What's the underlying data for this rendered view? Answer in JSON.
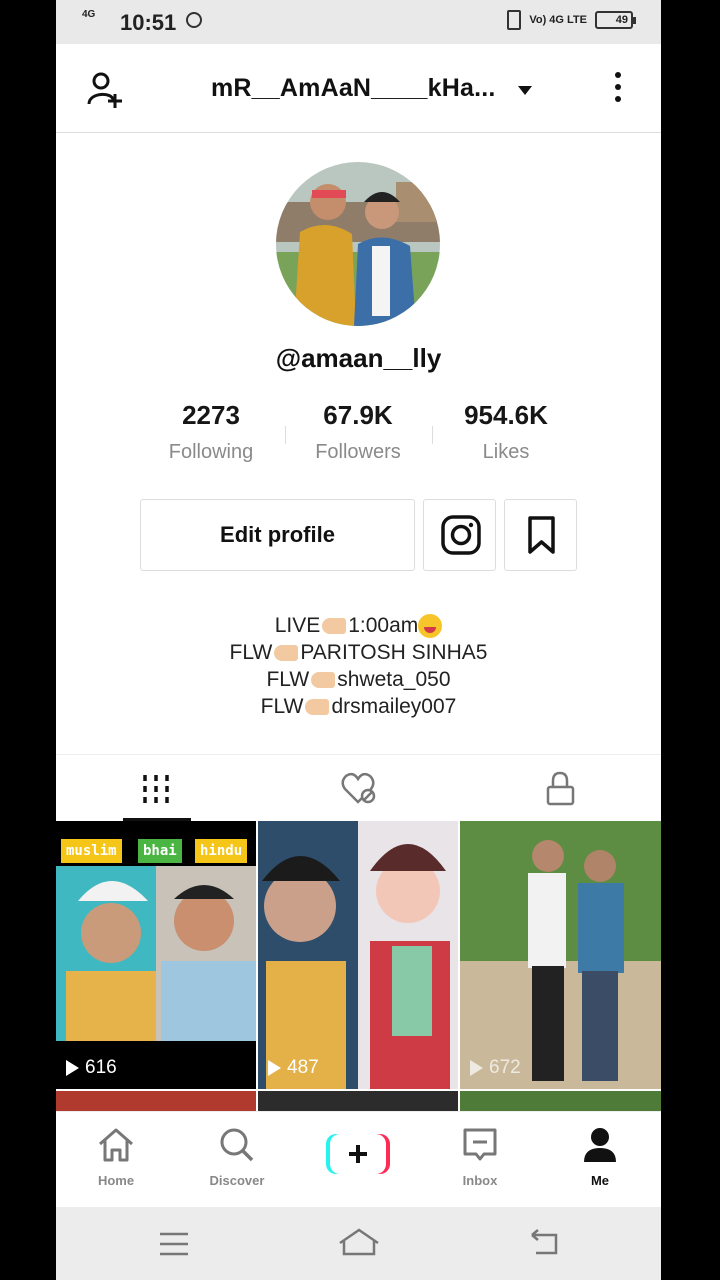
{
  "status": {
    "network": "4G",
    "time": "10:51",
    "volte": "Vo) 4G LTE",
    "battery": "49"
  },
  "header": {
    "username": "mR__AmAaN____kHa..."
  },
  "profile": {
    "handle": "@amaan__lly",
    "stats": [
      {
        "value": "2273",
        "label": "Following"
      },
      {
        "value": "67.9K",
        "label": "Followers"
      },
      {
        "value": "954.6K",
        "label": "Likes"
      }
    ],
    "edit_label": "Edit profile",
    "bio": [
      {
        "pre": "LIVE",
        "post": "1:00am"
      },
      {
        "pre": "FLW",
        "post": "PARITOSH SINHA5"
      },
      {
        "pre": "FLW",
        "post": "shweta_050"
      },
      {
        "pre": "FLW",
        "post": "drsmailey007"
      }
    ]
  },
  "videos": [
    {
      "views": "616",
      "tags": [
        "muslim",
        "bhai",
        "hindu"
      ]
    },
    {
      "views": "487"
    },
    {
      "views": "672"
    }
  ],
  "nav": [
    {
      "label": "Home"
    },
    {
      "label": "Discover"
    },
    {
      "label": "Inbox"
    },
    {
      "label": "Me"
    }
  ],
  "colors": {
    "tiktok_cyan": "#25f4ee",
    "tiktok_red": "#fe2c55",
    "tag_yellow": "#f5c518",
    "tag_green": "#4bb543"
  }
}
